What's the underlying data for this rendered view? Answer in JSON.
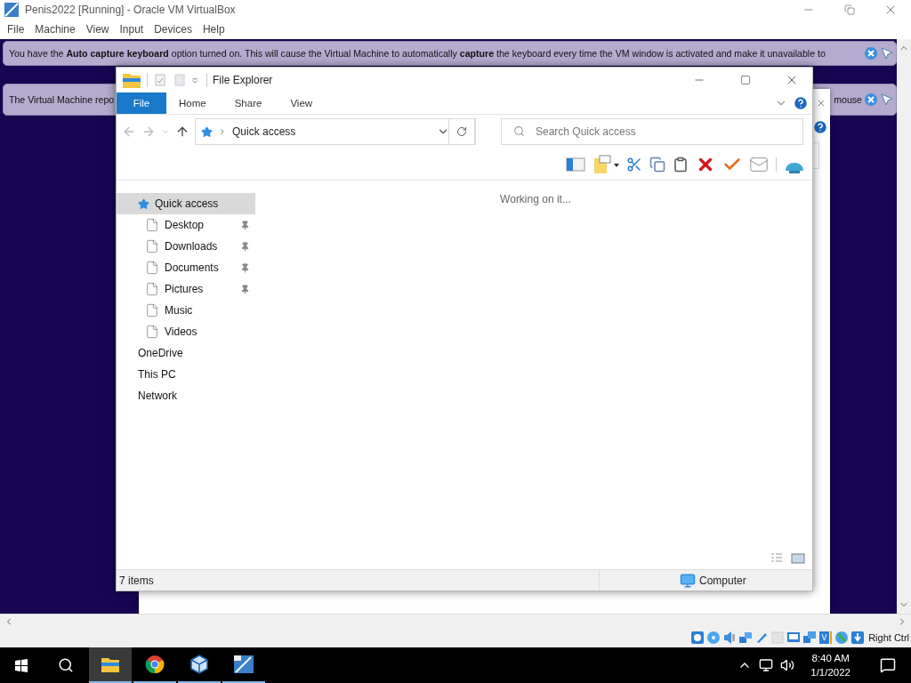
{
  "host_window": {
    "title": "Penis2022 [Running] - Oracle VM VirtualBox"
  },
  "menu": [
    "File",
    "Machine",
    "View",
    "Input",
    "Devices",
    "Help"
  ],
  "notices": [
    {
      "text": "You have the **Auto capture keyboard** option turned on. This will cause the Virtual Machine to automatically **capture** the keyboard every time the VM window is activated and make it unavailable to"
    },
    {
      "text": "The Virtual Machine repo",
      "tail": "mouse"
    }
  ],
  "file_explorer": {
    "title": "File Explorer",
    "tabs": [
      {
        "label": "File",
        "selected": true
      },
      {
        "label": "Home",
        "selected": false
      },
      {
        "label": "Share",
        "selected": false
      },
      {
        "label": "View",
        "selected": false
      }
    ],
    "address": "Quick access",
    "search": {
      "placeholder": "Search Quick access"
    },
    "nav": [
      {
        "label": "Quick access",
        "selected": true,
        "children": [
          {
            "label": "Desktop",
            "pinned": true,
            "selected": false
          },
          {
            "label": "Downloads",
            "pinned": true,
            "selected": false
          },
          {
            "label": "Documents",
            "pinned": true,
            "selected": false
          },
          {
            "label": "Pictures",
            "pinned": true,
            "selected": false
          },
          {
            "label": "Music",
            "pinned": false,
            "selected": false
          },
          {
            "label": "Videos",
            "pinned": false,
            "selected": false
          }
        ]
      },
      {
        "label": "OneDrive",
        "selected": false
      },
      {
        "label": "This PC",
        "selected": false
      },
      {
        "label": "Network",
        "selected": false
      }
    ],
    "message": "Working on it...",
    "status": {
      "count": "7 items",
      "zone": "Computer"
    }
  },
  "status_bar": {
    "host_key": "Right Ctrl"
  },
  "taskbar": {
    "apps": [
      {
        "kind": "explorer",
        "active": true
      },
      {
        "kind": "chrome",
        "active": false
      },
      {
        "kind": "virtualbox",
        "active": false
      },
      {
        "kind": "app",
        "active": false
      }
    ],
    "time": "8:40 AM",
    "date": "1/1/2022"
  }
}
